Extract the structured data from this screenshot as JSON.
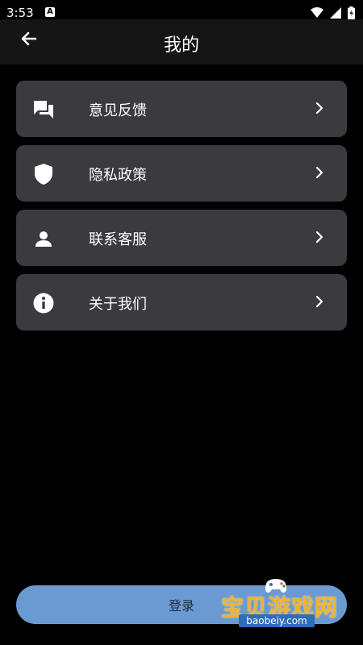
{
  "status": {
    "time": "3:53",
    "notification_icon": "a-icon"
  },
  "header": {
    "title": "我的"
  },
  "menu": {
    "items": [
      {
        "label": "意见反馈",
        "icon": "feedback-icon"
      },
      {
        "label": "隐私政策",
        "icon": "shield-icon"
      },
      {
        "label": "联系客服",
        "icon": "person-icon"
      },
      {
        "label": "关于我们",
        "icon": "info-icon"
      }
    ]
  },
  "login": {
    "label": "登录"
  },
  "watermark": {
    "title": "宝贝游戏网",
    "url": "baobeiy.com"
  },
  "colors": {
    "background": "#000000",
    "card": "#3a3a3f",
    "login_button": "#6a9ad1"
  }
}
